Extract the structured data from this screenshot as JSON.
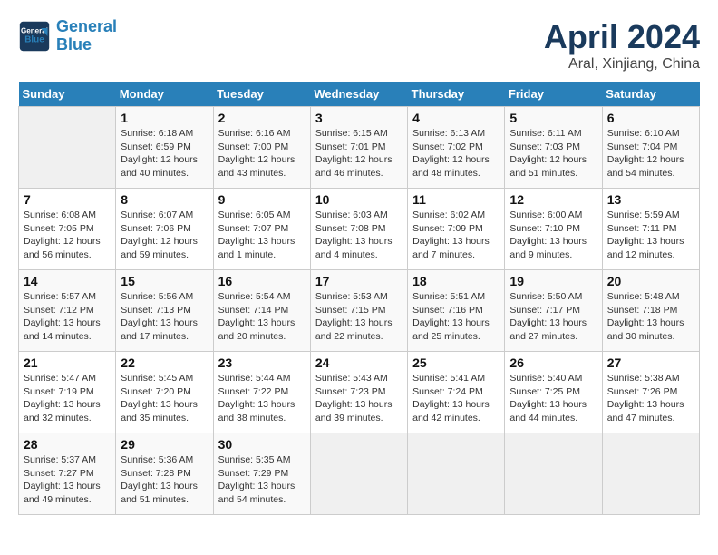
{
  "header": {
    "logo_line1": "General",
    "logo_line2": "Blue",
    "title": "April 2024",
    "subtitle": "Aral, Xinjiang, China"
  },
  "columns": [
    "Sunday",
    "Monday",
    "Tuesday",
    "Wednesday",
    "Thursday",
    "Friday",
    "Saturday"
  ],
  "weeks": [
    [
      {
        "day": "",
        "info": ""
      },
      {
        "day": "1",
        "info": "Sunrise: 6:18 AM\nSunset: 6:59 PM\nDaylight: 12 hours\nand 40 minutes."
      },
      {
        "day": "2",
        "info": "Sunrise: 6:16 AM\nSunset: 7:00 PM\nDaylight: 12 hours\nand 43 minutes."
      },
      {
        "day": "3",
        "info": "Sunrise: 6:15 AM\nSunset: 7:01 PM\nDaylight: 12 hours\nand 46 minutes."
      },
      {
        "day": "4",
        "info": "Sunrise: 6:13 AM\nSunset: 7:02 PM\nDaylight: 12 hours\nand 48 minutes."
      },
      {
        "day": "5",
        "info": "Sunrise: 6:11 AM\nSunset: 7:03 PM\nDaylight: 12 hours\nand 51 minutes."
      },
      {
        "day": "6",
        "info": "Sunrise: 6:10 AM\nSunset: 7:04 PM\nDaylight: 12 hours\nand 54 minutes."
      }
    ],
    [
      {
        "day": "7",
        "info": "Sunrise: 6:08 AM\nSunset: 7:05 PM\nDaylight: 12 hours\nand 56 minutes."
      },
      {
        "day": "8",
        "info": "Sunrise: 6:07 AM\nSunset: 7:06 PM\nDaylight: 12 hours\nand 59 minutes."
      },
      {
        "day": "9",
        "info": "Sunrise: 6:05 AM\nSunset: 7:07 PM\nDaylight: 13 hours\nand 1 minute."
      },
      {
        "day": "10",
        "info": "Sunrise: 6:03 AM\nSunset: 7:08 PM\nDaylight: 13 hours\nand 4 minutes."
      },
      {
        "day": "11",
        "info": "Sunrise: 6:02 AM\nSunset: 7:09 PM\nDaylight: 13 hours\nand 7 minutes."
      },
      {
        "day": "12",
        "info": "Sunrise: 6:00 AM\nSunset: 7:10 PM\nDaylight: 13 hours\nand 9 minutes."
      },
      {
        "day": "13",
        "info": "Sunrise: 5:59 AM\nSunset: 7:11 PM\nDaylight: 13 hours\nand 12 minutes."
      }
    ],
    [
      {
        "day": "14",
        "info": "Sunrise: 5:57 AM\nSunset: 7:12 PM\nDaylight: 13 hours\nand 14 minutes."
      },
      {
        "day": "15",
        "info": "Sunrise: 5:56 AM\nSunset: 7:13 PM\nDaylight: 13 hours\nand 17 minutes."
      },
      {
        "day": "16",
        "info": "Sunrise: 5:54 AM\nSunset: 7:14 PM\nDaylight: 13 hours\nand 20 minutes."
      },
      {
        "day": "17",
        "info": "Sunrise: 5:53 AM\nSunset: 7:15 PM\nDaylight: 13 hours\nand 22 minutes."
      },
      {
        "day": "18",
        "info": "Sunrise: 5:51 AM\nSunset: 7:16 PM\nDaylight: 13 hours\nand 25 minutes."
      },
      {
        "day": "19",
        "info": "Sunrise: 5:50 AM\nSunset: 7:17 PM\nDaylight: 13 hours\nand 27 minutes."
      },
      {
        "day": "20",
        "info": "Sunrise: 5:48 AM\nSunset: 7:18 PM\nDaylight: 13 hours\nand 30 minutes."
      }
    ],
    [
      {
        "day": "21",
        "info": "Sunrise: 5:47 AM\nSunset: 7:19 PM\nDaylight: 13 hours\nand 32 minutes."
      },
      {
        "day": "22",
        "info": "Sunrise: 5:45 AM\nSunset: 7:20 PM\nDaylight: 13 hours\nand 35 minutes."
      },
      {
        "day": "23",
        "info": "Sunrise: 5:44 AM\nSunset: 7:22 PM\nDaylight: 13 hours\nand 38 minutes."
      },
      {
        "day": "24",
        "info": "Sunrise: 5:43 AM\nSunset: 7:23 PM\nDaylight: 13 hours\nand 39 minutes."
      },
      {
        "day": "25",
        "info": "Sunrise: 5:41 AM\nSunset: 7:24 PM\nDaylight: 13 hours\nand 42 minutes."
      },
      {
        "day": "26",
        "info": "Sunrise: 5:40 AM\nSunset: 7:25 PM\nDaylight: 13 hours\nand 44 minutes."
      },
      {
        "day": "27",
        "info": "Sunrise: 5:38 AM\nSunset: 7:26 PM\nDaylight: 13 hours\nand 47 minutes."
      }
    ],
    [
      {
        "day": "28",
        "info": "Sunrise: 5:37 AM\nSunset: 7:27 PM\nDaylight: 13 hours\nand 49 minutes."
      },
      {
        "day": "29",
        "info": "Sunrise: 5:36 AM\nSunset: 7:28 PM\nDaylight: 13 hours\nand 51 minutes."
      },
      {
        "day": "30",
        "info": "Sunrise: 5:35 AM\nSunset: 7:29 PM\nDaylight: 13 hours\nand 54 minutes."
      },
      {
        "day": "",
        "info": ""
      },
      {
        "day": "",
        "info": ""
      },
      {
        "day": "",
        "info": ""
      },
      {
        "day": "",
        "info": ""
      }
    ]
  ]
}
